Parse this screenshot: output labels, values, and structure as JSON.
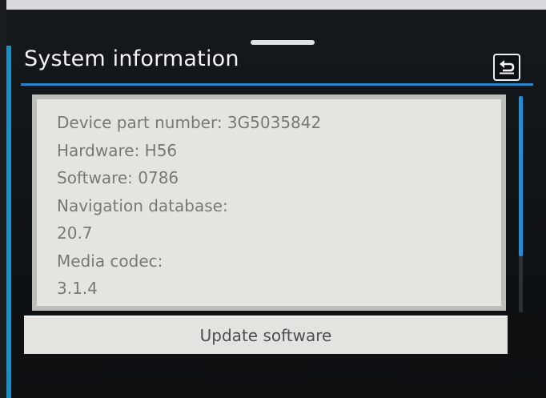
{
  "header": {
    "title": "System information",
    "back_icon": "back-arrow-icon"
  },
  "info": {
    "items": [
      "Device part number: 3G5035842",
      "Hardware: H56",
      "Software: 0786",
      "Navigation database:",
      "20.7",
      "Media codec:",
      "3.1.4"
    ]
  },
  "actions": {
    "update_label": "Update software"
  },
  "colors": {
    "accent": "#2a84c6",
    "panel_bg": "#e4e4e0",
    "text_muted": "#787875",
    "screen_bg": "#121517"
  }
}
